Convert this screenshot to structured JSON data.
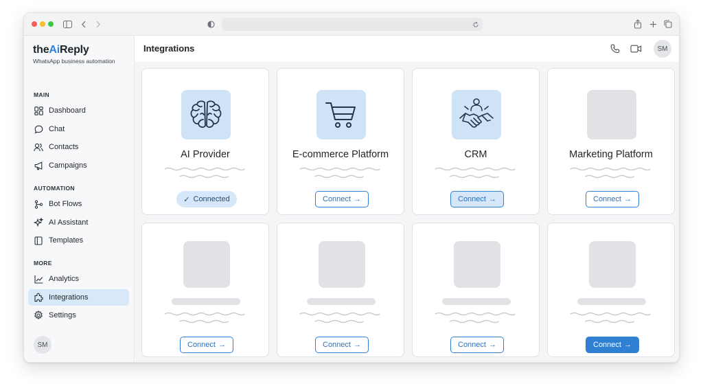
{
  "app": {
    "brand_prefix": "the",
    "brand_ai": "Ai",
    "brand_suffix": "Reply",
    "tagline": "WhatsApp business automation",
    "accent_color": "#2f80d8"
  },
  "sidebar": {
    "sections": [
      {
        "label": "MAIN"
      },
      {
        "label": "AUTOMATION"
      },
      {
        "label": "MORE"
      }
    ],
    "items": [
      {
        "label": "Dashboard",
        "icon": "dashboard-icon"
      },
      {
        "label": "Chat",
        "icon": "chat-bubble-icon"
      },
      {
        "label": "Contacts",
        "icon": "users-icon"
      },
      {
        "label": "Campaigns",
        "icon": "megaphone-icon"
      },
      {
        "label": "Bot Flows",
        "icon": "flow-icon"
      },
      {
        "label": "AI Assistant",
        "icon": "sparkles-icon"
      },
      {
        "label": "Templates",
        "icon": "template-icon"
      },
      {
        "label": "Analytics",
        "icon": "chart-line-icon"
      },
      {
        "label": "Integrations",
        "icon": "puzzle-icon",
        "active": true
      },
      {
        "label": "Settings",
        "icon": "gear-icon"
      }
    ],
    "avatar_initials": "SM"
  },
  "header": {
    "title": "Integrations",
    "avatar_initials": "SM"
  },
  "cards": [
    {
      "title": "AI Provider",
      "icon": "brain-icon",
      "button": "Connected",
      "status": "connected"
    },
    {
      "title": "E-commerce Platform",
      "icon": "shopping-cart-icon",
      "button": "Connect",
      "status": "available"
    },
    {
      "title": "CRM",
      "icon": "handshake-icon",
      "button": "Connect",
      "status": "available"
    },
    {
      "title": "Marketing Platform",
      "icon": "placeholder",
      "button": "Connect",
      "status": "available"
    },
    {
      "title": "",
      "icon": "placeholder",
      "button": "Connect",
      "status": "available"
    },
    {
      "title": "",
      "icon": "placeholder",
      "button": "Connect",
      "status": "available"
    },
    {
      "title": "",
      "icon": "placeholder",
      "button": "Connect",
      "status": "available"
    },
    {
      "title": "",
      "icon": "placeholder",
      "button": "Connect",
      "status": "available"
    }
  ],
  "glyphs": {
    "check": "✓",
    "arrow": "→"
  }
}
